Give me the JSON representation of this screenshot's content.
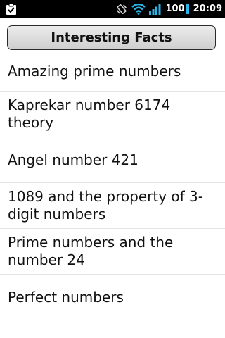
{
  "status_bar": {
    "notification_icon": "clipboard-check-icon",
    "vibrate_icon": "vibrate-icon",
    "wifi_icon": "wifi-icon",
    "signal_icon": "signal-bars-icon",
    "battery_level": "100",
    "time": "20:09",
    "accent_color": "#2ab6ea"
  },
  "header": {
    "title": "Interesting Facts"
  },
  "facts": [
    "Amazing prime numbers",
    "Kaprekar number 6174 theory",
    "Angel number 421",
    "1089 and the property of 3-digit numbers",
    "Prime numbers and the number 24",
    "Perfect numbers"
  ]
}
